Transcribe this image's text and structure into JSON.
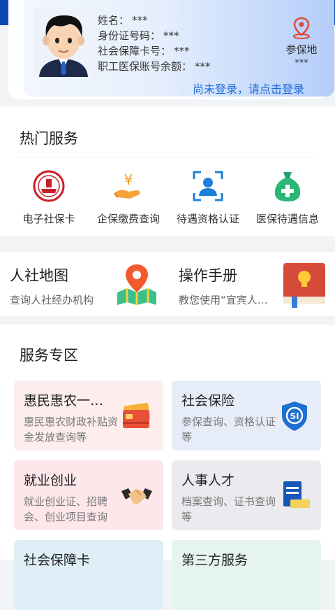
{
  "profile": {
    "fields": [
      {
        "label": "姓名：",
        "value": "***"
      },
      {
        "label": "身份证号码：",
        "value": "***"
      },
      {
        "label": "社会保障卡号：",
        "value": "***"
      },
      {
        "label": "职工医保账号余额：",
        "value": "***"
      }
    ],
    "location_label": "参保地",
    "location_value": "***",
    "login_prompt": "尚未登录，请点击登录"
  },
  "hot_services": {
    "title": "热门服务",
    "items": [
      {
        "label": "电子社保卡",
        "icon": "social-security-card-icon"
      },
      {
        "label": "企保缴费查询",
        "icon": "payment-hand-icon"
      },
      {
        "label": "待遇资格认证",
        "icon": "face-verify-icon"
      },
      {
        "label": "医保待遇信息",
        "icon": "medical-bag-icon"
      }
    ]
  },
  "quick_links": [
    {
      "title": "人社地图",
      "subtitle": "查询人社经办机构",
      "icon": "map-pin-icon"
    },
    {
      "title": "操作手册",
      "subtitle": "教您使用“宜宾人…",
      "icon": "manual-book-icon"
    }
  ],
  "service_zone": {
    "title": "服务专区",
    "cards": [
      {
        "title": "惠民惠农一…",
        "desc": "惠民惠农财政补贴资金发放查询等",
        "icon": "cards-icon",
        "bg": "#fdeeed"
      },
      {
        "title": "社会保险",
        "desc": "参保查询、资格认证等",
        "icon": "shield-si-icon",
        "bg": "#e6edf8"
      },
      {
        "title": "就业创业",
        "desc": "就业创业证、招聘会、创业项目查询",
        "icon": "handshake-icon",
        "bg": "#fde7eb"
      },
      {
        "title": "人事人才",
        "desc": "档案查询、证书查询等",
        "icon": "certificate-book-icon",
        "bg": "#ebebef"
      },
      {
        "title": "社会保障卡",
        "desc": "",
        "icon": "",
        "bg": "#dfeff8"
      },
      {
        "title": "第三方服务",
        "desc": "",
        "icon": "",
        "bg": "#e5f5ee"
      }
    ]
  },
  "colors": {
    "accent": "#1f6bd6",
    "header_blue": "#1a5fd8"
  }
}
